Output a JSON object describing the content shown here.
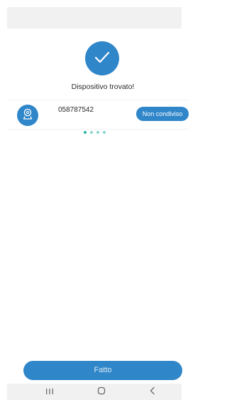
{
  "status": {
    "title": "Dispositivo trovato!",
    "icon": "checkmark-icon",
    "color": "#2f86c9"
  },
  "device": {
    "icon": "camera-icon",
    "id": "058787542",
    "share_label": "Non condiviso"
  },
  "pager": {
    "dot_count": 4,
    "dot_color": "#26b3a8"
  },
  "footer": {
    "done_label": "Fatto"
  },
  "navbar": {
    "recents_icon": "recents-icon",
    "home_icon": "home-icon",
    "back_icon": "back-icon"
  }
}
